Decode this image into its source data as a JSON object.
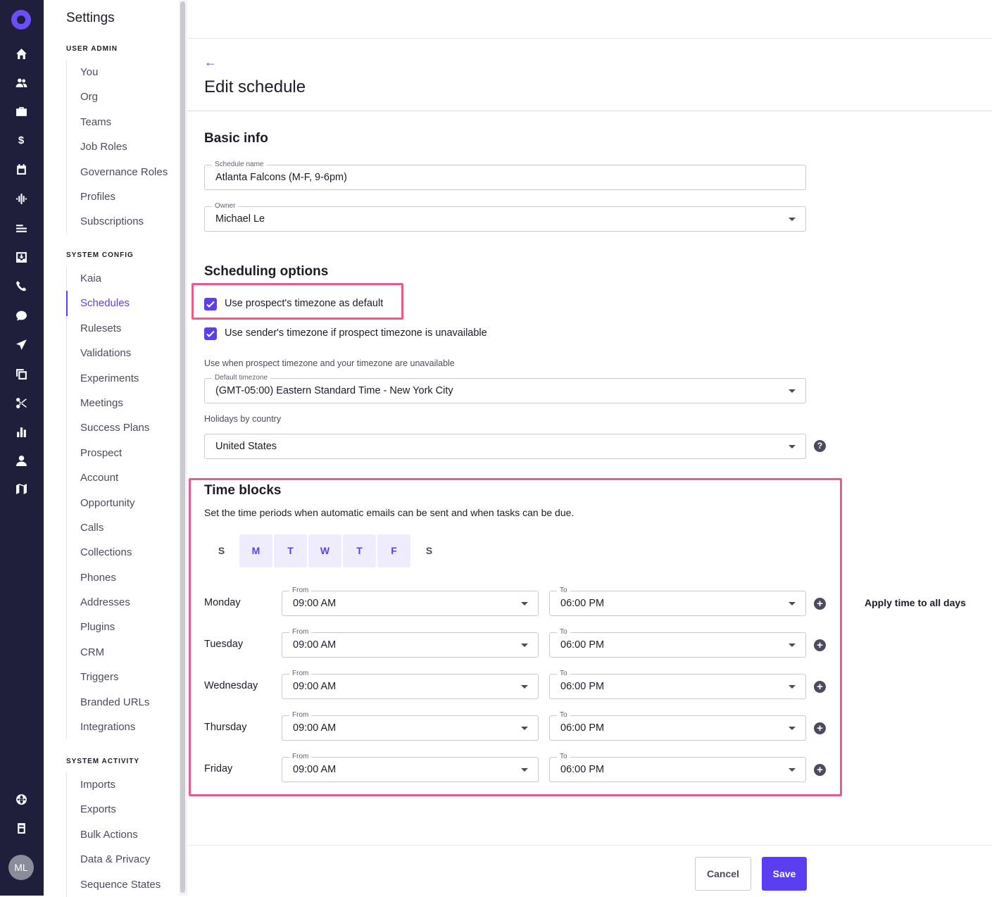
{
  "rail": {
    "icons": [
      "logo-icon",
      "home-icon",
      "people-icon",
      "briefcase-icon",
      "dollar-icon",
      "calendar-icon",
      "waveform-icon",
      "list-icon",
      "inbox-icon",
      "phone-icon",
      "chat-icon",
      "send-icon",
      "copy-icon",
      "scissors-icon",
      "bar-chart-icon",
      "person-icon",
      "map-icon",
      "globe-icon",
      "badge-icon"
    ],
    "avatar": "ML"
  },
  "settings": {
    "title": "Settings",
    "user_admin": {
      "heading": "USER ADMIN",
      "items": [
        "You",
        "Org",
        "Teams",
        "Job Roles",
        "Governance Roles",
        "Profiles",
        "Subscriptions"
      ]
    },
    "system_config": {
      "heading": "SYSTEM CONFIG",
      "items": [
        "Kaia",
        "Schedules",
        "Rulesets",
        "Validations",
        "Experiments",
        "Meetings",
        "Success Plans",
        "Prospect",
        "Account",
        "Opportunity",
        "Calls",
        "Collections",
        "Phones",
        "Addresses",
        "Plugins",
        "CRM",
        "Triggers",
        "Branded URLs",
        "Integrations"
      ],
      "active": "Schedules"
    },
    "system_activity": {
      "heading": "SYSTEM ACTIVITY",
      "items": [
        "Imports",
        "Exports",
        "Bulk Actions",
        "Data & Privacy",
        "Sequence States"
      ]
    }
  },
  "page": {
    "back": "←",
    "title": "Edit schedule"
  },
  "basic_info": {
    "heading": "Basic info",
    "schedule_name_label": "Schedule name",
    "schedule_name_value": "Atlanta Falcons (M-F, 9-6pm)",
    "owner_label": "Owner",
    "owner_value": "Michael Le"
  },
  "scheduling": {
    "heading": "Scheduling options",
    "use_prospect_tz": "Use prospect's timezone as default",
    "use_sender_tz": "Use sender's timezone if prospect timezone is unavailable",
    "fallback_hint": "Use when prospect timezone and your timezone are unavailable",
    "default_tz_label": "Default timezone",
    "default_tz_value": "(GMT-05:00) Eastern Standard Time - New York City",
    "holidays_label": "Holidays by country",
    "holidays_value": "United States"
  },
  "time_blocks": {
    "heading": "Time blocks",
    "description": "Set the time periods when automatic emails can be sent and when tasks can be due.",
    "day_tabs": [
      "S",
      "M",
      "T",
      "W",
      "T",
      "F",
      "S"
    ],
    "from_label": "From",
    "to_label": "To",
    "rows": [
      {
        "day": "Monday",
        "from": "09:00 AM",
        "to": "06:00 PM"
      },
      {
        "day": "Tuesday",
        "from": "09:00 AM",
        "to": "06:00 PM"
      },
      {
        "day": "Wednesday",
        "from": "09:00 AM",
        "to": "06:00 PM"
      },
      {
        "day": "Thursday",
        "from": "09:00 AM",
        "to": "06:00 PM"
      },
      {
        "day": "Friday",
        "from": "09:00 AM",
        "to": "06:00 PM"
      }
    ],
    "apply_all": "Apply time to all days"
  },
  "footer": {
    "cancel": "Cancel",
    "save": "Save"
  },
  "colors": {
    "accent": "#5a3ff2",
    "highlight": "#f0588d",
    "rail": "#1d1f3b"
  }
}
